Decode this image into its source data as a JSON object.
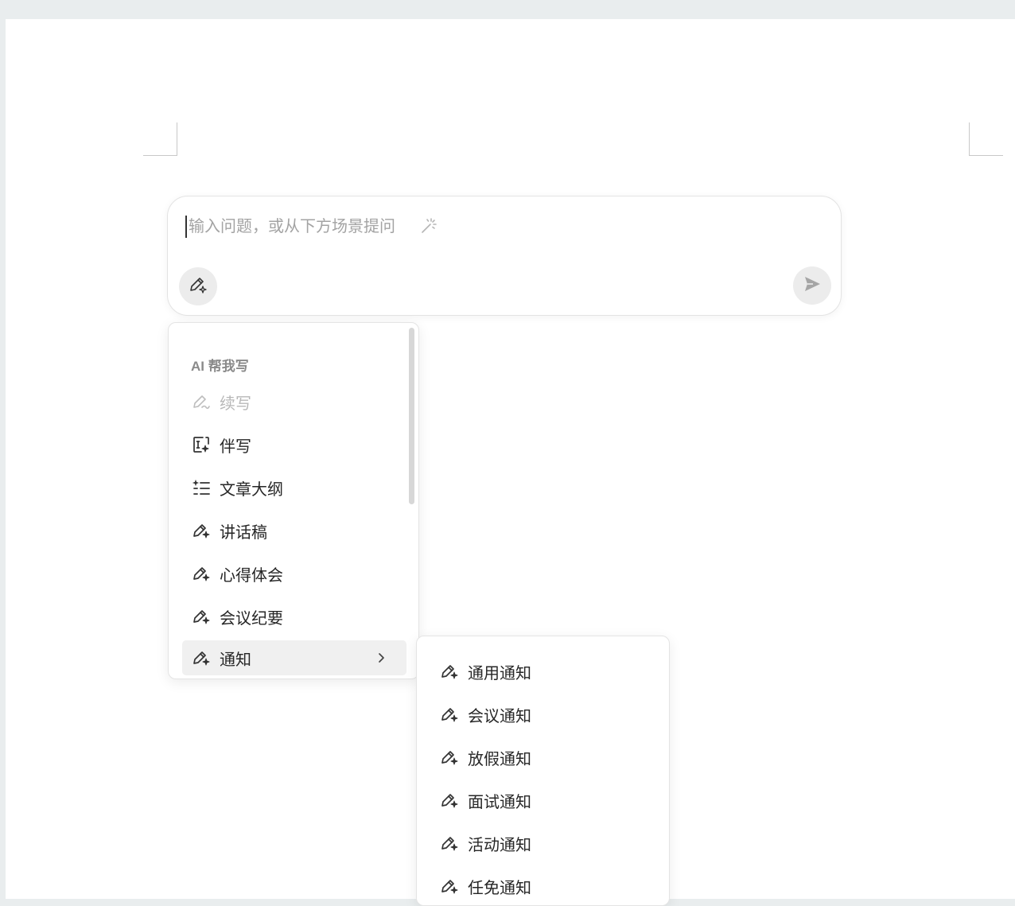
{
  "ai_box": {
    "input_placeholder": "输入问题，或从下方场景提问",
    "icons": {
      "magic": "magic-wand-icon",
      "pen": "ai-pen-icon",
      "send": "send-icon"
    }
  },
  "menu": {
    "section_title": "AI 帮我写",
    "items": [
      {
        "label": "续写",
        "icon": "pen-squiggle-icon",
        "disabled": true
      },
      {
        "label": "伴写",
        "icon": "companion-write-icon"
      },
      {
        "label": "文章大纲",
        "icon": "outline-list-icon"
      },
      {
        "label": "讲话稿",
        "icon": "ai-pen-icon"
      },
      {
        "label": "心得体会",
        "icon": "ai-pen-icon"
      },
      {
        "label": "会议纪要",
        "icon": "ai-pen-icon"
      },
      {
        "label": "通知",
        "icon": "ai-pen-icon",
        "active": true,
        "has_submenu": true
      }
    ]
  },
  "submenu": {
    "items": [
      {
        "label": "通用通知",
        "icon": "ai-pen-icon"
      },
      {
        "label": "会议通知",
        "icon": "ai-pen-icon"
      },
      {
        "label": "放假通知",
        "icon": "ai-pen-icon"
      },
      {
        "label": "面试通知",
        "icon": "ai-pen-icon"
      },
      {
        "label": "活动通知",
        "icon": "ai-pen-icon"
      },
      {
        "label": "任免通知",
        "icon": "ai-pen-icon"
      }
    ]
  },
  "colors": {
    "page_bg": "#ffffff",
    "window_bg": "#e9edee",
    "active_item_bg": "#f0f0f0",
    "muted_text": "#8a8a8a"
  }
}
